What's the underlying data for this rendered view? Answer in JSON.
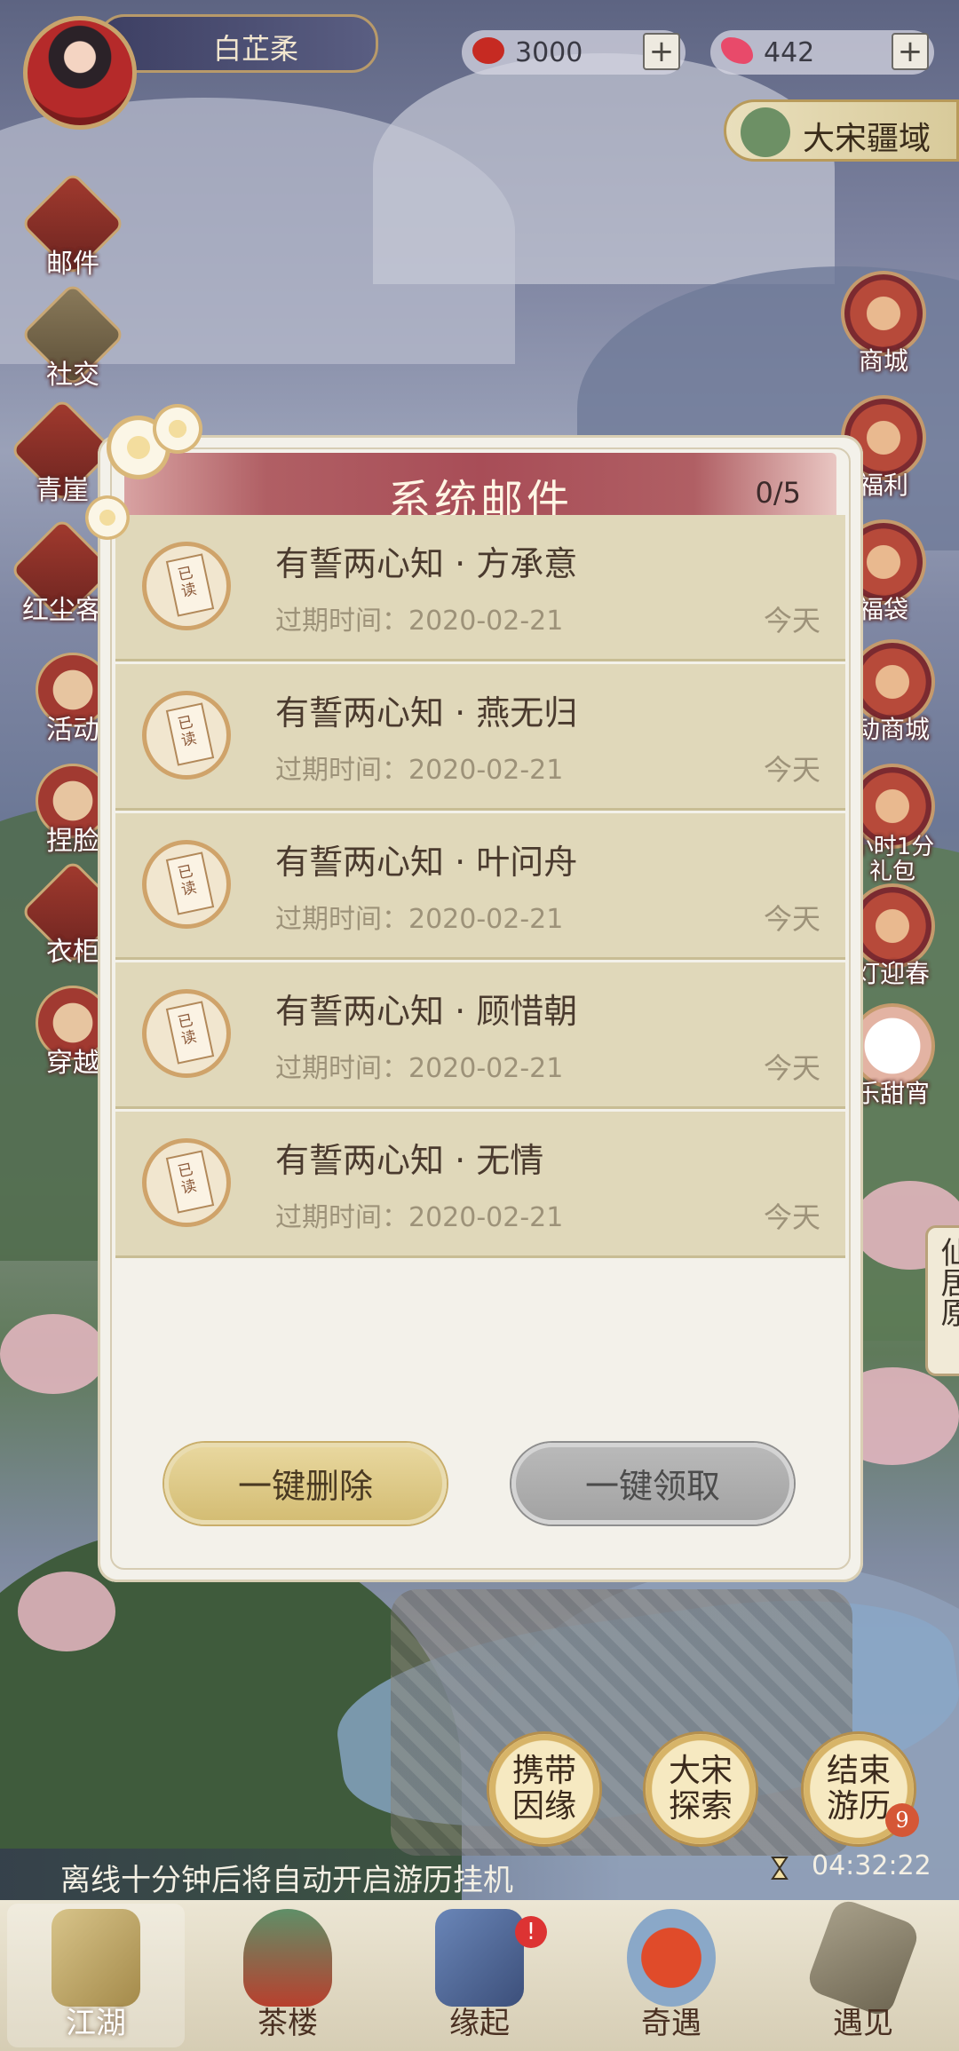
{
  "player": {
    "name": "白芷柔"
  },
  "currency": [
    {
      "icon": "red-bean-icon",
      "value": "3000",
      "plus": "+"
    },
    {
      "icon": "butterfly-icon",
      "value": "442",
      "plus": "+"
    }
  ],
  "realm": {
    "label": "大宋疆域"
  },
  "left_menu": [
    {
      "label": "邮件",
      "icon": "mail-icon"
    },
    {
      "label": "社交",
      "icon": "social-icon"
    },
    {
      "label": "青崖",
      "icon": "book-icon"
    },
    {
      "label": "红尘客",
      "icon": "gate-icon"
    },
    {
      "label": "活动",
      "icon": "fan-icon"
    },
    {
      "label": "捏脸",
      "icon": "face-icon"
    },
    {
      "label": "衣柜",
      "icon": "robe-icon"
    },
    {
      "label": "穿越",
      "icon": "portal-icon"
    }
  ],
  "right_menu": [
    {
      "label": "商城",
      "icon": "shop-icon"
    },
    {
      "label": "福利",
      "icon": "welfare-icon"
    },
    {
      "label": "福袋",
      "icon": "lucky-bag-icon"
    },
    {
      "label": "动商城",
      "icon": "event-shop-icon"
    },
    {
      "label": "小时1分礼包",
      "icon": "gift-icon"
    },
    {
      "label": "灯迎春",
      "icon": "lantern-icon"
    },
    {
      "label": "乐甜宵",
      "icon": "dumpling-icon"
    }
  ],
  "xianju": "仙居原",
  "modal": {
    "title": "系统邮件",
    "count": "0/5",
    "mails": [
      {
        "title": "有誓两心知 · 方承意",
        "expire": "过期时间：2020-02-21",
        "date": "今天",
        "badge": "已读"
      },
      {
        "title": "有誓两心知 · 燕无归",
        "expire": "过期时间：2020-02-21",
        "date": "今天",
        "badge": "已读"
      },
      {
        "title": "有誓两心知 · 叶问舟",
        "expire": "过期时间：2020-02-21",
        "date": "今天",
        "badge": "已读"
      },
      {
        "title": "有誓两心知 · 顾惜朝",
        "expire": "过期时间：2020-02-21",
        "date": "今天",
        "badge": "已读"
      },
      {
        "title": "有誓两心知 · 无情",
        "expire": "过期时间：2020-02-21",
        "date": "今天",
        "badge": "已读"
      }
    ],
    "delete_all": "一键删除",
    "claim_all": "一键领取"
  },
  "actions": [
    {
      "label": "携带因缘"
    },
    {
      "label": "大宋探索"
    },
    {
      "label": "结束游历",
      "badge": "9"
    }
  ],
  "offline_notice": "离线十分钟后将自动开启游历挂机",
  "timer": "04:32:22",
  "nav": [
    {
      "label": "江湖",
      "active": true
    },
    {
      "label": "茶楼"
    },
    {
      "label": "缘起",
      "badge": "!"
    },
    {
      "label": "奇遇"
    },
    {
      "label": "遇见"
    }
  ],
  "colors": {
    "modal_header": "#a84d57",
    "mail_row": "#e0d8ba",
    "delete_btn": "#d4bd74",
    "claim_btn": "#a3a3a3"
  }
}
